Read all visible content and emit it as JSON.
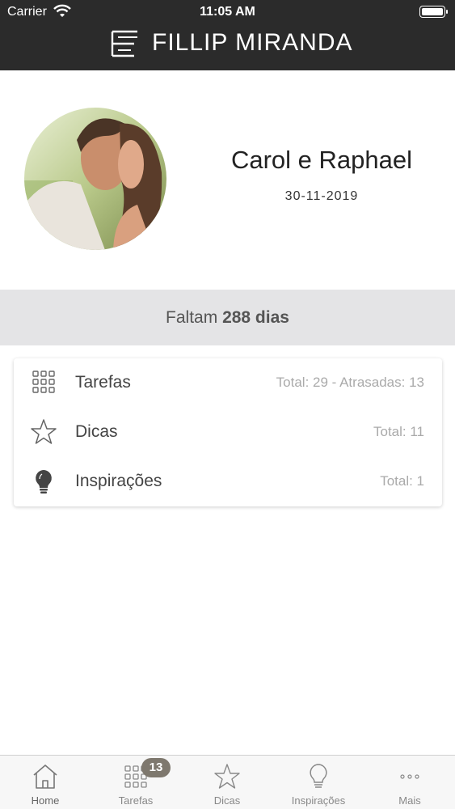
{
  "status_bar": {
    "carrier": "Carrier",
    "time": "11:05 AM"
  },
  "header": {
    "brand": "FILLIP MIRANDA"
  },
  "profile": {
    "couple_name": "Carol e Raphael",
    "wedding_date": "30-11-2019"
  },
  "countdown": {
    "prefix": "Faltam",
    "days": "288 dias"
  },
  "summary": [
    {
      "label": "Tarefas",
      "meta": "Total: 29 - Atrasadas: 13",
      "icon": "grid-icon"
    },
    {
      "label": "Dicas",
      "meta": "Total: 11",
      "icon": "star-icon"
    },
    {
      "label": "Inspirações",
      "meta": "Total: 1",
      "icon": "lightbulb-icon"
    }
  ],
  "tabbar": {
    "tabs": [
      {
        "label": "Home",
        "icon": "home-icon"
      },
      {
        "label": "Tarefas",
        "icon": "grid-icon"
      },
      {
        "label": "Dicas",
        "icon": "star-icon"
      },
      {
        "label": "Inspirações",
        "icon": "lightbulb-icon"
      },
      {
        "label": "Mais",
        "icon": "more-icon"
      }
    ],
    "tarefas_badge": "13"
  },
  "colors": {
    "header_bg": "#2b2b2b",
    "countdown_bg": "#e4e4e6",
    "badge_bg": "#7e786e"
  }
}
